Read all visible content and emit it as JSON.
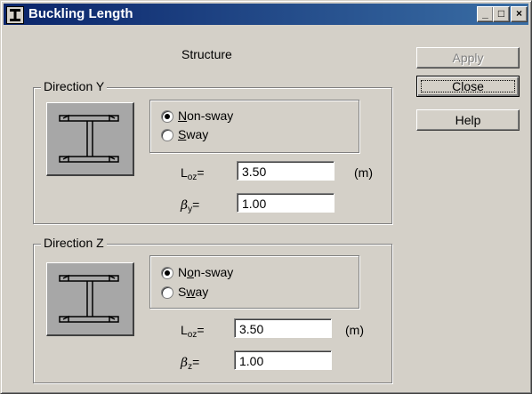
{
  "window": {
    "title": "Buckling Length",
    "controls": {
      "minimize": "_",
      "maximize": "□",
      "close": "×"
    }
  },
  "structure_label": "Structure",
  "buttons": {
    "apply": "Apply",
    "close": "Close",
    "help": "Help"
  },
  "direction_y": {
    "title": "Direction Y",
    "radio_nonsway_pre": "",
    "radio_nonsway_key": "N",
    "radio_nonsway_post": "on-sway",
    "radio_sway_pre": "",
    "radio_sway_key": "S",
    "radio_sway_post": "way",
    "selected": "Non-sway",
    "length_label_main": "L",
    "length_label_sub": "oz",
    "length_label_eq": "=",
    "length_value": "3.50",
    "length_unit": "(m)",
    "beta_label_main": "β",
    "beta_label_sub": "y",
    "beta_label_eq": "=",
    "beta_value": "1.00"
  },
  "direction_z": {
    "title": "Direction Z",
    "radio_nonsway_pre": "N",
    "radio_nonsway_key": "o",
    "radio_nonsway_post": "n-sway",
    "radio_sway_pre": "S",
    "radio_sway_key": "w",
    "radio_sway_post": "ay",
    "selected": "Non-sway",
    "length_label_main": "L",
    "length_label_sub": "oz",
    "length_label_eq": "=",
    "length_value": "3.50",
    "length_unit": "(m)",
    "beta_label_main": "β",
    "beta_label_sub": "z",
    "beta_label_eq": "=",
    "beta_value": "1.00"
  },
  "icons": {
    "app": "ibeam-app-icon",
    "section": "ibeam-section-icon"
  }
}
